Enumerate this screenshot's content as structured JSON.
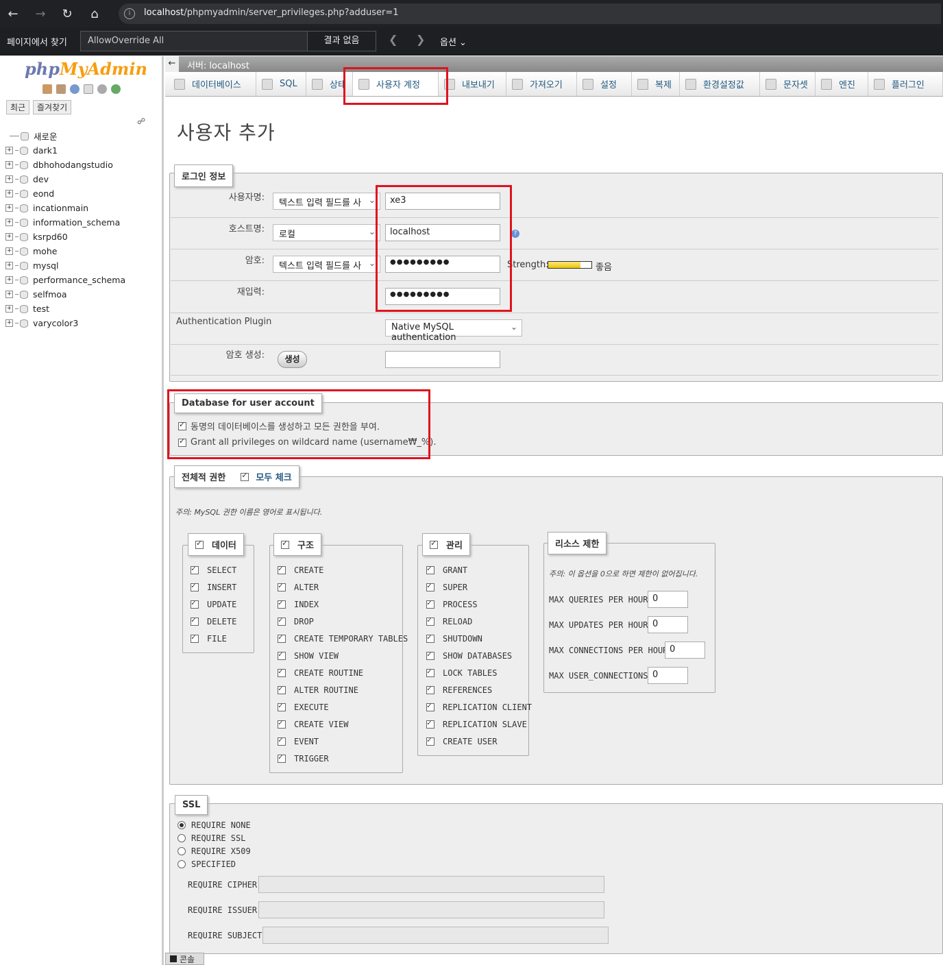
{
  "browser": {
    "url_host": "localhost",
    "url_path": "/phpmyadmin/server_privileges.php?adduser=1"
  },
  "findbar": {
    "label": "페이지에서 찾기",
    "query": "AllowOverride All",
    "result": "결과 없음",
    "options": "옵션"
  },
  "sidebar": {
    "logo_php": "php",
    "logo_myadmin": "MyAdmin",
    "recent": "최근",
    "favorites": "즐겨찾기",
    "new_item": "새로운",
    "databases": [
      "dark1",
      "dbhohodangstudio",
      "dev",
      "eond",
      "incationmain",
      "information_schema",
      "ksrpd60",
      "mohe",
      "mysql",
      "performance_schema",
      "selfmoa",
      "test",
      "varycolor3"
    ]
  },
  "serverbar": {
    "title": "서버: localhost"
  },
  "tabs": [
    "데이터베이스",
    "SQL",
    "상태",
    "사용자 계정",
    "내보내기",
    "가져오기",
    "설정",
    "복제",
    "환경설정값",
    "문자셋",
    "엔진",
    "플러그인"
  ],
  "page_title": "사용자 추가",
  "login": {
    "legend": "로그인 정보",
    "username_label": "사용자명:",
    "username_mode": "텍스트 입력 필드를 사",
    "username_value": "xe3",
    "hostname_label": "호스트명:",
    "hostname_mode": "로컬",
    "hostname_value": "localhost",
    "password_label": "암호:",
    "password_mode": "텍스트 입력 필드를 사",
    "password_value": "●●●●●●●●●",
    "strength_label": "Strength:",
    "strength_text": "좋음",
    "retype_label": "재입력:",
    "retype_value": "●●●●●●●●●",
    "auth_plugin_label": "Authentication Plugin",
    "auth_plugin_value": "Native MySQL authentication",
    "generate_label": "암호 생성:",
    "generate_button": "생성"
  },
  "db_account": {
    "legend": "Database for user account",
    "option1": "동명의 데이터베이스를 생성하고 모든 권한을 부여.",
    "option2": "Grant all privileges on wildcard name (username₩_%)."
  },
  "global_privs": {
    "legend": "전체적 권한",
    "check_all": "모두 체크",
    "note": "주의: MySQL 권한 이름은 영어로 표시됩니다.",
    "data": {
      "legend": "데이터",
      "items": [
        "SELECT",
        "INSERT",
        "UPDATE",
        "DELETE",
        "FILE"
      ]
    },
    "structure": {
      "legend": "구조",
      "items": [
        "CREATE",
        "ALTER",
        "INDEX",
        "DROP",
        "CREATE TEMPORARY TABLES",
        "SHOW VIEW",
        "CREATE ROUTINE",
        "ALTER ROUTINE",
        "EXECUTE",
        "CREATE VIEW",
        "EVENT",
        "TRIGGER"
      ]
    },
    "admin": {
      "legend": "관리",
      "items": [
        "GRANT",
        "SUPER",
        "PROCESS",
        "RELOAD",
        "SHUTDOWN",
        "SHOW DATABASES",
        "LOCK TABLES",
        "REFERENCES",
        "REPLICATION CLIENT",
        "REPLICATION SLAVE",
        "CREATE USER"
      ]
    },
    "resources": {
      "legend": "리소스 제한",
      "note": "주의: 이 옵션을 0으로 하면 제한이 없어집니다.",
      "items": [
        {
          "label": "MAX QUERIES PER HOUR",
          "value": "0"
        },
        {
          "label": "MAX UPDATES PER HOUR",
          "value": "0"
        },
        {
          "label": "MAX CONNECTIONS PER HOUR",
          "value": "0"
        },
        {
          "label": "MAX USER_CONNECTIONS",
          "value": "0"
        }
      ]
    }
  },
  "ssl": {
    "legend": "SSL",
    "options": [
      "REQUIRE NONE",
      "REQUIRE SSL",
      "REQUIRE X509",
      "SPECIFIED"
    ],
    "fields": [
      "REQUIRE CIPHER",
      "REQUIRE ISSUER",
      "REQUIRE SUBJECT"
    ]
  },
  "console": "콘솔"
}
